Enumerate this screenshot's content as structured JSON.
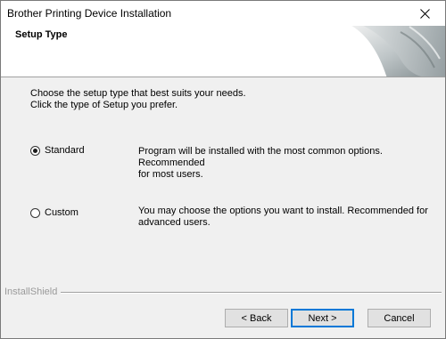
{
  "window": {
    "title": "Brother Printing Device Installation"
  },
  "header": {
    "title": "Setup Type"
  },
  "instructions": {
    "line1": "Choose the setup type that best suits your needs.",
    "line2": "Click the type of Setup you prefer."
  },
  "options": [
    {
      "label": "Standard",
      "selected": true,
      "desc1": "Program will be installed with the most common options. Recommended",
      "desc2": "for most users."
    },
    {
      "label": "Custom",
      "selected": false,
      "desc1": "You may choose the options you want to install. Recommended for",
      "desc2": "advanced users."
    }
  ],
  "footer": {
    "brand": "InstallShield"
  },
  "buttons": {
    "back": "< Back",
    "next": "Next >",
    "cancel": "Cancel"
  }
}
